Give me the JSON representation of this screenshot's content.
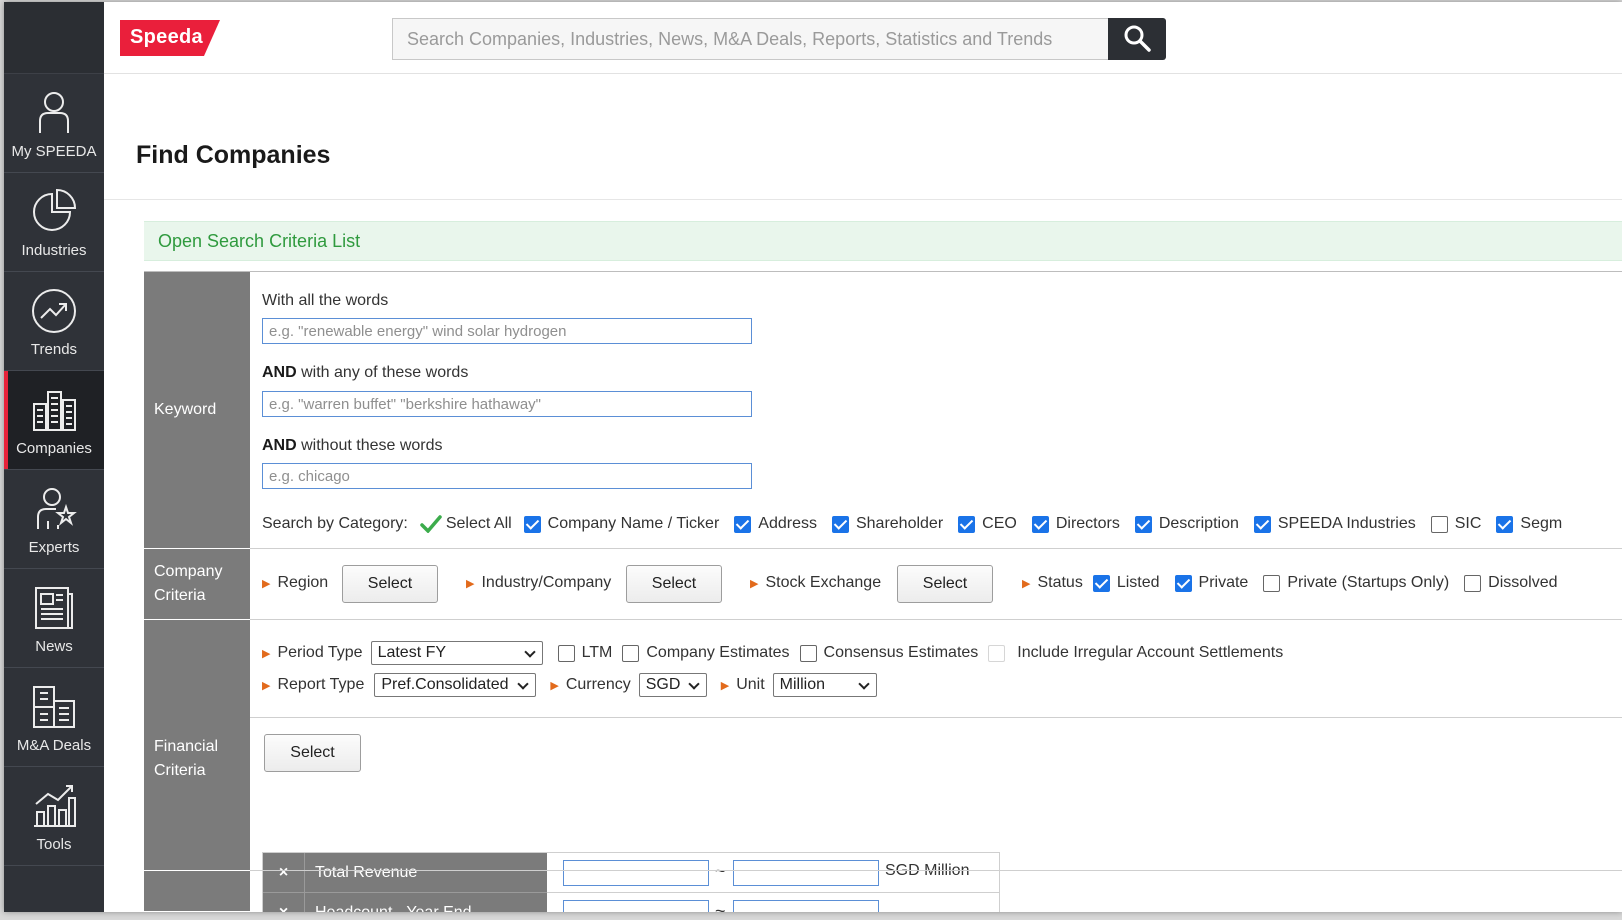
{
  "brand": {
    "logo_text": "Speeda",
    "accent_color": "#ea1f3b"
  },
  "search": {
    "placeholder": "Search Companies, Industries, News, M&A Deals, Reports, Statistics and Trends"
  },
  "sidebar": {
    "items": [
      {
        "label": "My SPEEDA",
        "icon": "user-icon"
      },
      {
        "label": "Industries",
        "icon": "pie-chart-icon"
      },
      {
        "label": "Trends",
        "icon": "trend-icon"
      },
      {
        "label": "Companies",
        "icon": "buildings-icon",
        "active": true
      },
      {
        "label": "Experts",
        "icon": "expert-icon"
      },
      {
        "label": "News",
        "icon": "news-icon"
      },
      {
        "label": "M&A Deals",
        "icon": "deals-icon"
      },
      {
        "label": "Tools",
        "icon": "tools-chart-icon"
      }
    ]
  },
  "page": {
    "title": "Find Companies",
    "criteria_link": "Open Search Criteria List"
  },
  "keyword": {
    "label": "Keyword",
    "all_words_label": "With all the words",
    "all_words_placeholder": "e.g. \"renewable energy\" wind solar hydrogen",
    "any_words_bold": "AND",
    "any_words_label": " with any of these words",
    "any_words_placeholder": "e.g. \"warren buffet\" \"berkshire hathaway\"",
    "without_words_bold": "AND",
    "without_words_label": " without these words",
    "without_words_placeholder": "e.g. chicago",
    "category_label": "Search by Category:",
    "select_all": "Select All",
    "categories": [
      {
        "label": "Company Name / Ticker",
        "checked": true
      },
      {
        "label": "Address",
        "checked": true
      },
      {
        "label": "Shareholder",
        "checked": true
      },
      {
        "label": "CEO",
        "checked": true
      },
      {
        "label": "Directors",
        "checked": true
      },
      {
        "label": "Description",
        "checked": true
      },
      {
        "label": "SPEEDA Industries",
        "checked": true
      },
      {
        "label": "SIC",
        "checked": false
      },
      {
        "label": "Segm",
        "checked": true
      }
    ]
  },
  "company_criteria": {
    "label_line1": "Company",
    "label_line2": "Criteria",
    "region_label": "Region",
    "industry_label": "Industry/Company",
    "exchange_label": "Stock Exchange",
    "select_label": "Select",
    "status_label": "Status",
    "status_options": [
      {
        "label": "Listed",
        "checked": true
      },
      {
        "label": "Private",
        "checked": true
      },
      {
        "label": "Private (Startups Only)",
        "checked": false
      },
      {
        "label": "Dissolved",
        "checked": false
      }
    ]
  },
  "financial_criteria": {
    "label_line1": "Financial",
    "label_line2": "Criteria",
    "period_type_label": "Period Type",
    "period_type_value": "Latest FY",
    "ltm_label": "LTM",
    "company_estimates_label": "Company Estimates",
    "consensus_label": "Consensus Estimates",
    "irregular_label": "Include Irregular Account Settlements",
    "report_type_label": "Report Type",
    "report_type_value": "Pref.Consolidated",
    "currency_label": "Currency",
    "currency_value": "SGD",
    "unit_label": "Unit",
    "unit_value": "Million",
    "select_label": "Select",
    "remove_symbol": "×",
    "tilde": "~",
    "rows": [
      {
        "name": "Total Revenue",
        "unit": "SGD Million"
      },
      {
        "name": "Headcount - Year End",
        "unit": ""
      }
    ]
  }
}
